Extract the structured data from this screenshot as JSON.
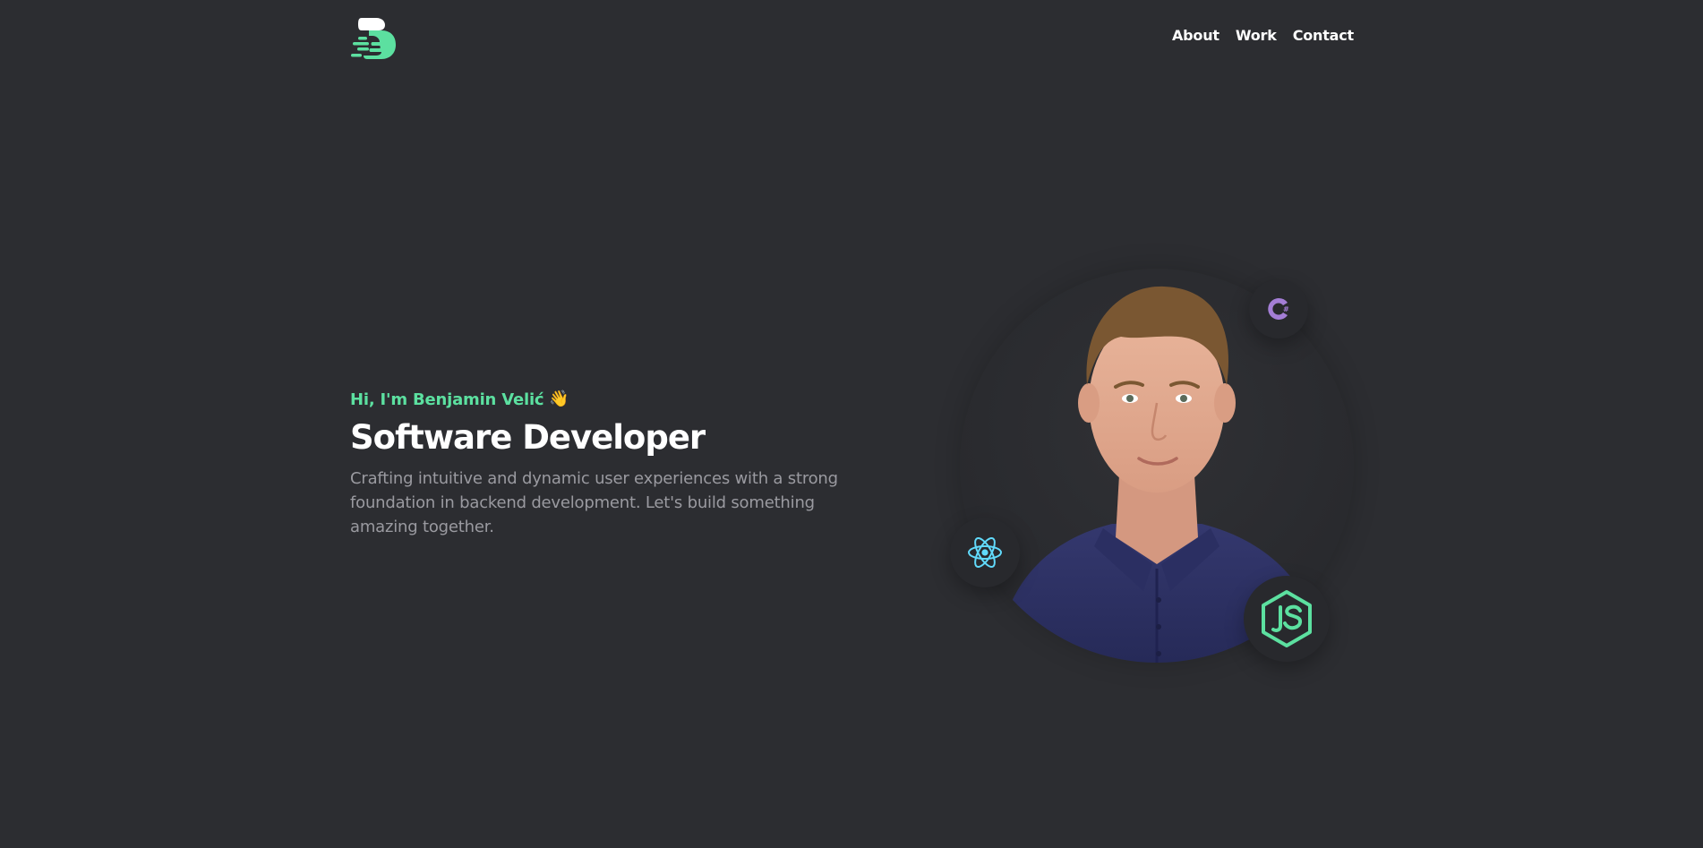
{
  "header": {
    "logo_icon": "brand-logo-icon",
    "nav": {
      "about": "About",
      "work": "Work",
      "contact": "Contact"
    }
  },
  "hero": {
    "greeting": "Hi, I'm Benjamin Velić",
    "wave_emoji": "👋",
    "title": "Software Developer",
    "description": "Crafting intuitive and dynamic user experiences with a strong foundation in backend development. Let's build something amazing together."
  },
  "portrait": {
    "photo": "profile-photo",
    "badges": [
      "csharp-icon",
      "react-icon",
      "nodejs-icon"
    ]
  },
  "colors": {
    "background": "#2c2d31",
    "accent": "#5ce0a0",
    "text": "#ffffff",
    "muted_text": "#9a9aa0",
    "csharp": "#a47ed6",
    "react": "#61dafb",
    "nodejs": "#5ce0a0"
  }
}
